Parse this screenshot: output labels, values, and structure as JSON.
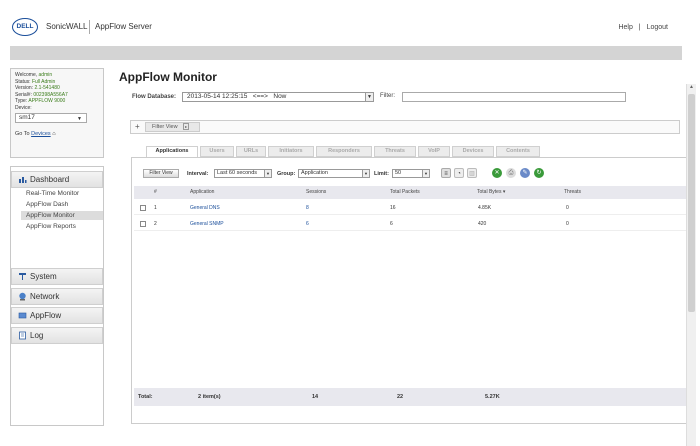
{
  "header": {
    "logo_text": "DELL",
    "brand_sonic": "SonicWALL",
    "brand_appflow": "AppFlow Server",
    "help": "Help",
    "separator": "|",
    "logout": "Logout"
  },
  "sidebar": {
    "info": [
      {
        "label": "Welcome,",
        "value": "admin"
      },
      {
        "label": "Status:",
        "value": "Full Admin"
      },
      {
        "label": "Version:",
        "value": "2.1-541480"
      },
      {
        "label": "Serial#:",
        "value": "002398A556A7"
      },
      {
        "label": "Type:",
        "value": "APPFLOW 9000"
      },
      {
        "label": "Device:",
        "value": ""
      }
    ],
    "device": "sm17",
    "goto_prefix": "Go To",
    "goto_link": "Devices",
    "categories": [
      {
        "label": "Dashboard"
      },
      {
        "label": "System"
      },
      {
        "label": "Network"
      },
      {
        "label": "AppFlow"
      },
      {
        "label": "Log"
      }
    ],
    "dashboard_items": [
      "Real-Time Monitor",
      "AppFlow Dash",
      "AppFlow Monitor",
      "AppFlow Reports"
    ]
  },
  "main": {
    "title": "AppFlow Monitor",
    "flow_db_label": "Flow Database:",
    "flow_db_value": "2013-05-14 12:25:15   <==>   Now",
    "filter_label": "Filter:",
    "filter_value": "",
    "filterview_plus": "+",
    "filterview_btn": "Filter View",
    "tabs": [
      "Applications",
      "Users",
      "URLs",
      "Initiators",
      "Responders",
      "Threats",
      "VoIP",
      "Devices",
      "Contents"
    ],
    "active_tab": "Applications",
    "toolbar": {
      "filter_view_btn": "Filter View",
      "interval_label": "Interval:",
      "interval_value": "Last 60 seconds",
      "group_label": "Group:",
      "group_value": "Application",
      "limit_label": "Limit:",
      "limit_value": "50"
    },
    "table": {
      "headers": [
        "#",
        "Application",
        "Sessions",
        "Total Packets",
        "Total Bytes ▾",
        "Threats"
      ],
      "rows": [
        {
          "num": "1",
          "app": "General DNS",
          "sessions": "8",
          "packets": "16",
          "bytes": "4.85K",
          "threats": "0"
        },
        {
          "num": "2",
          "app": "General SNMP",
          "sessions": "6",
          "packets": "6",
          "bytes": "420",
          "threats": "0"
        }
      ],
      "total": {
        "label": "Total:",
        "items": "2 item(s)",
        "sessions": "14",
        "packets": "22",
        "bytes": "5.27K"
      }
    }
  },
  "colors": {
    "accent": "#1a4e9a",
    "green_value": "#3a7c1a"
  }
}
